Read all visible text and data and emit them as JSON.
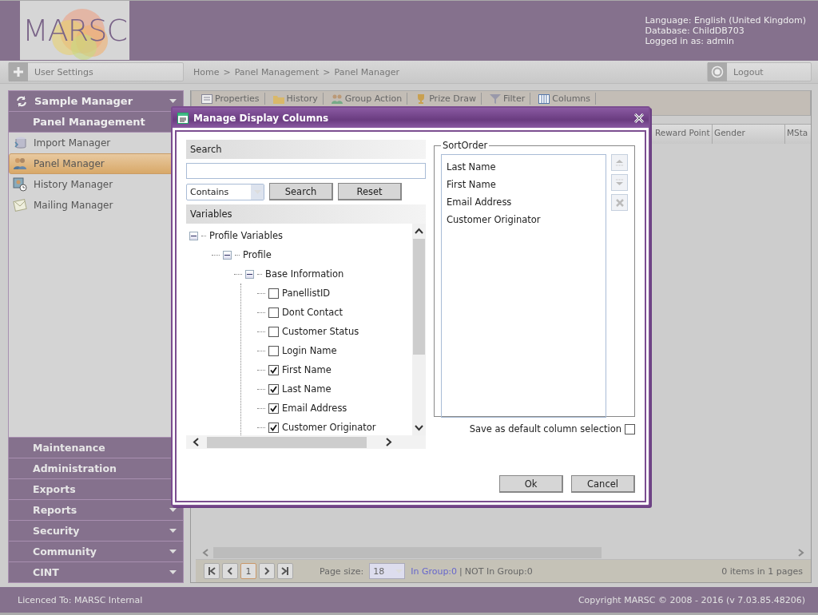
{
  "header": {
    "logo": "MARSC",
    "info": [
      "Language: English (United Kingdom)",
      "Database: ChildDB703",
      "Logged in as: admin"
    ]
  },
  "topbar": {
    "user_settings": "User Settings",
    "breadcrumb": [
      "Home",
      "Panel Management",
      "Panel Manager"
    ],
    "breadcrumb_separator": ">",
    "logout": "Logout"
  },
  "sidebar": {
    "section": {
      "label": "Sample Manager",
      "expandable": true
    },
    "group": "Panel Management",
    "items": [
      {
        "label": "Import Manager",
        "selected": false
      },
      {
        "label": "Panel Manager",
        "selected": true
      },
      {
        "label": "History Manager",
        "selected": false
      },
      {
        "label": "Mailing Manager",
        "selected": false
      }
    ],
    "sections": [
      {
        "label": "Maintenance",
        "expandable": false
      },
      {
        "label": "Administration",
        "expandable": false
      },
      {
        "label": "Exports",
        "expandable": false
      },
      {
        "label": "Reports",
        "expandable": true
      },
      {
        "label": "Security",
        "expandable": true
      },
      {
        "label": "Community",
        "expandable": true
      },
      {
        "label": "CINT",
        "expandable": true
      }
    ]
  },
  "toolbar": [
    "Properties",
    "History",
    "Group Action",
    "Prize Draw",
    "Filter",
    "Columns"
  ],
  "grid": {
    "columns": [
      "Reward Point",
      "Gender",
      "MSta"
    ]
  },
  "pager": {
    "page": "1",
    "page_size_label": "Page size:",
    "page_size": "18",
    "in_group": "In Group:0",
    "separator": "|",
    "not_in_group": "NOT In Group:0",
    "summary": "0 items in 1 pages"
  },
  "dialog": {
    "title": "Manage Display Columns",
    "search_header": "Search",
    "match": "Contains",
    "search_button": "Search",
    "reset_button": "Reset",
    "variables_header": "Variables",
    "tree": [
      {
        "label": "Profile Variables",
        "expanded": true,
        "children": [
          {
            "label": "Profile",
            "expanded": true,
            "children": [
              {
                "label": "Base Information",
                "expanded": true,
                "children": [
                  {
                    "label": "PanellistID",
                    "kind": "checkbox",
                    "checked": false
                  },
                  {
                    "label": "Dont Contact",
                    "kind": "checkbox",
                    "checked": false
                  },
                  {
                    "label": "Customer Status",
                    "kind": "checkbox",
                    "checked": false
                  },
                  {
                    "label": "Login Name",
                    "kind": "checkbox",
                    "checked": false
                  },
                  {
                    "label": "First Name",
                    "kind": "checkbox",
                    "checked": true
                  },
                  {
                    "label": "Last Name",
                    "kind": "checkbox",
                    "checked": true
                  },
                  {
                    "label": "Email Address",
                    "kind": "checkbox",
                    "checked": true
                  },
                  {
                    "label": "Customer Originator",
                    "kind": "checkbox",
                    "checked": true
                  }
                ]
              }
            ]
          }
        ]
      }
    ],
    "sort_legend": "SortOrder",
    "sort_order": [
      "Last Name",
      "First Name",
      "Email Address",
      "Customer Originator"
    ],
    "save_default": {
      "label": "Save as default column selection",
      "checked": false
    },
    "ok": "Ok",
    "cancel": "Cancel"
  },
  "footer": {
    "licence": "Licenced To: MARSC Internal",
    "copyright": "Copyright MARSC © 2008 - 2016  (v 7.03.85.48206)"
  }
}
